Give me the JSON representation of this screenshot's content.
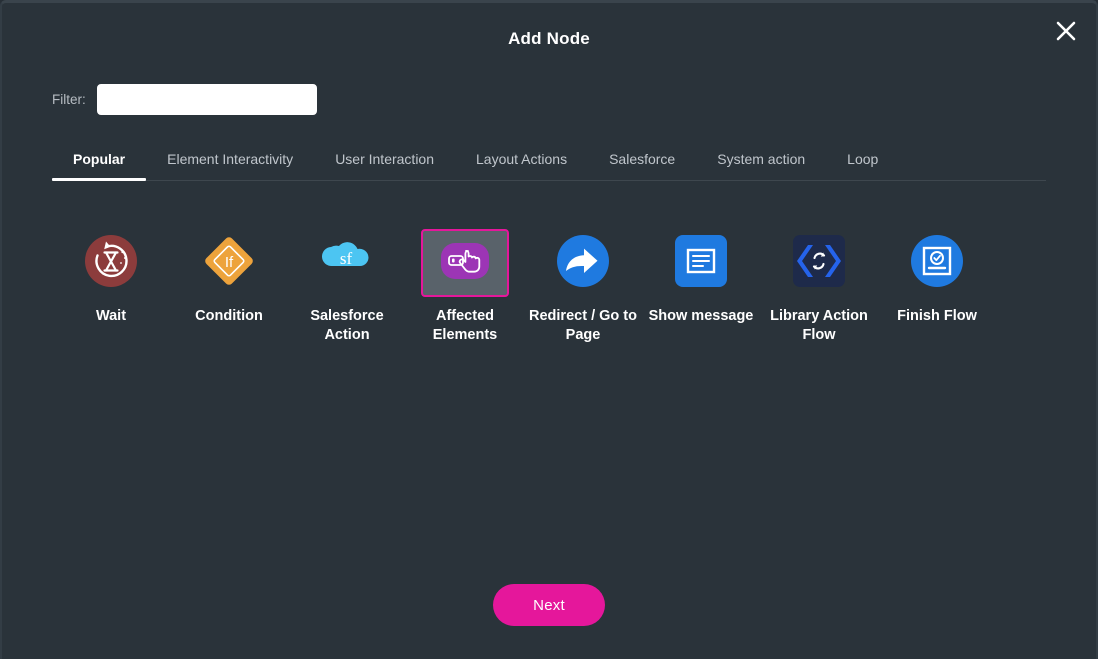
{
  "dialog": {
    "title": "Add Node",
    "close_icon": "close-icon"
  },
  "filter": {
    "label": "Filter:",
    "value": "",
    "placeholder": ""
  },
  "tabs": [
    {
      "label": "Popular",
      "active": true
    },
    {
      "label": "Element Interactivity",
      "active": false
    },
    {
      "label": "User Interaction",
      "active": false
    },
    {
      "label": "Layout Actions",
      "active": false
    },
    {
      "label": "Salesforce",
      "active": false
    },
    {
      "label": "System action",
      "active": false
    },
    {
      "label": "Loop",
      "active": false
    }
  ],
  "nodes": [
    {
      "label": "Wait",
      "icon": "hourglass-refresh-icon",
      "selected": false,
      "color": "#8c3c3c"
    },
    {
      "label": "Condition",
      "icon": "if-diamond-icon",
      "selected": false,
      "color": "#eda33c"
    },
    {
      "label": "Salesforce Action",
      "icon": "salesforce-cloud-icon",
      "selected": false,
      "color": "#4cc5f2"
    },
    {
      "label": "Affected Elements",
      "icon": "hand-pointer-icon",
      "selected": true,
      "color": "#9c35b5"
    },
    {
      "label": "Redirect / Go to Page",
      "icon": "share-arrow-icon",
      "selected": false,
      "color": "#1f7ae0"
    },
    {
      "label": "Show message",
      "icon": "message-document-icon",
      "selected": false,
      "color": "#1f7ae0"
    },
    {
      "label": "Library Action Flow",
      "icon": "code-refresh-icon",
      "selected": false,
      "color": "#1e2a4a"
    },
    {
      "label": "Finish Flow",
      "icon": "certificate-check-icon",
      "selected": false,
      "color": "#1f7ae0"
    }
  ],
  "footer": {
    "next_label": "Next"
  },
  "colors": {
    "background": "#2a333a",
    "accent": "#e5179b",
    "selected_fill": "#59626a"
  }
}
